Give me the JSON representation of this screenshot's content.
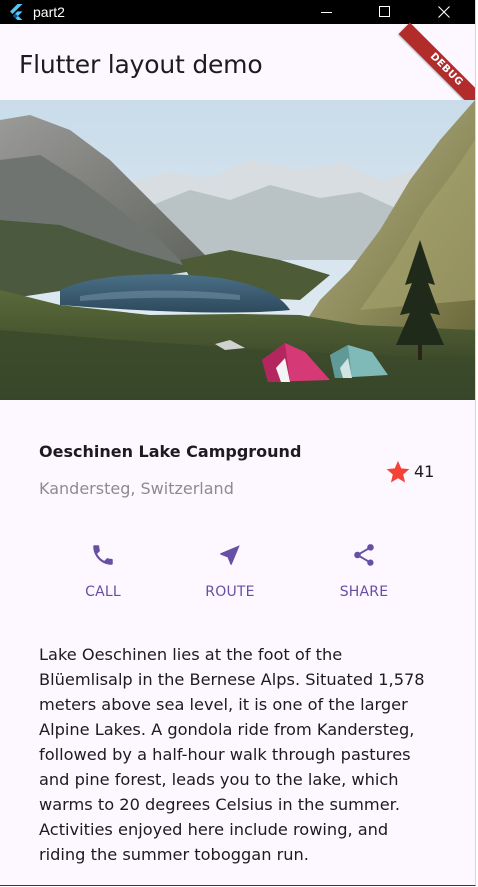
{
  "window": {
    "title": "part2",
    "controls": {
      "minimize_icon": "minimize-icon",
      "maximize_icon": "maximize-icon",
      "close_icon": "close-icon"
    }
  },
  "appbar": {
    "title": "Flutter layout demo",
    "debug_banner": "DEBUG"
  },
  "place": {
    "name": "Oeschinen Lake Campground",
    "location": "Kandersteg, Switzerland",
    "rating_count": "41",
    "rating_icon": "star-icon"
  },
  "actions": [
    {
      "label": "CALL",
      "icon": "phone-icon"
    },
    {
      "label": "ROUTE",
      "icon": "navigation-icon"
    },
    {
      "label": "SHARE",
      "icon": "share-icon"
    }
  ],
  "description": "Lake Oeschinen lies at the foot of the Blüemlisalp in the Bernese Alps. Situated 1,578 meters above sea level, it is one of the larger Alpine Lakes. A gondola ride from Kandersteg, followed by a half-hour walk through pastures and pine forest, leads you to the lake, which warms to 20 degrees Celsius in the summer. Activities enjoyed here include rowing, and riding the summer toboggan run.",
  "colors": {
    "accent": "#6750a4",
    "star": "#f44336",
    "background": "#fdf7ff",
    "debug_banner": "#b22c2c"
  }
}
